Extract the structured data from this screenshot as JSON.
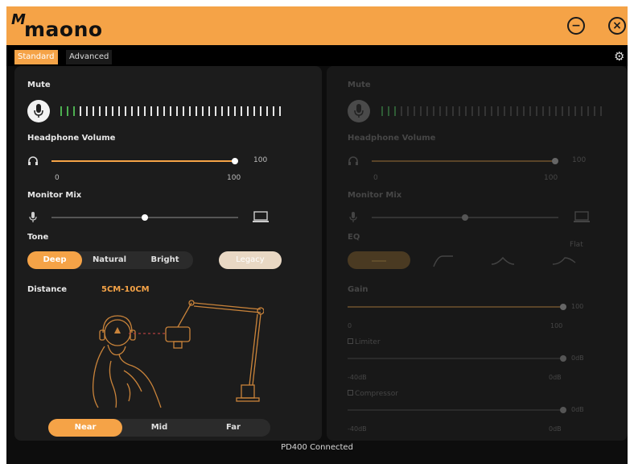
{
  "app": {
    "logo_mark": "M",
    "logo_text": "maono",
    "minimize_icon": "−",
    "close_icon": "×",
    "settings_icon": "⚙"
  },
  "tabs": {
    "standard": "Standard",
    "advanced": "Advanced"
  },
  "left": {
    "mute_label": "Mute",
    "headphone_label": "Headphone Volume",
    "headphone_value": "100",
    "headphone_min": "0",
    "headphone_max": "100",
    "headphone_level": 1.0,
    "monitor_label": "Monitor Mix",
    "monitor_level": 0.5,
    "tone_label": "Tone",
    "tone_options": [
      "Deep",
      "Natural",
      "Bright"
    ],
    "tone_selected": "Deep",
    "legacy_label": "Legacy",
    "distance_label": "Distance",
    "distance_value": "5CM-10CM",
    "distance_options": [
      "Near",
      "Mid",
      "Far"
    ],
    "distance_selected": "Near"
  },
  "right": {
    "mute_label": "Mute",
    "headphone_label": "Headphone Volume",
    "headphone_value": "100",
    "headphone_min": "0",
    "headphone_max": "100",
    "monitor_label": "Monitor Mix",
    "eq_label": "EQ",
    "eq_flat_label": "Flat",
    "gain_label": "Gain",
    "gain_value": "100",
    "gain_min": "0",
    "gain_max": "100",
    "limiter_label": "Limiter",
    "limiter_value": "0dB",
    "limiter_min": "-40dB",
    "limiter_max": "0dB",
    "compressor_label": "Compressor",
    "compressor_value": "0dB",
    "compressor_min": "-40dB",
    "compressor_max": "0dB"
  },
  "status": {
    "text": "PD400 Connected"
  },
  "colors": {
    "accent": "#f5a347",
    "background": "#0d0d0d",
    "panel": "#1c1c1c"
  }
}
